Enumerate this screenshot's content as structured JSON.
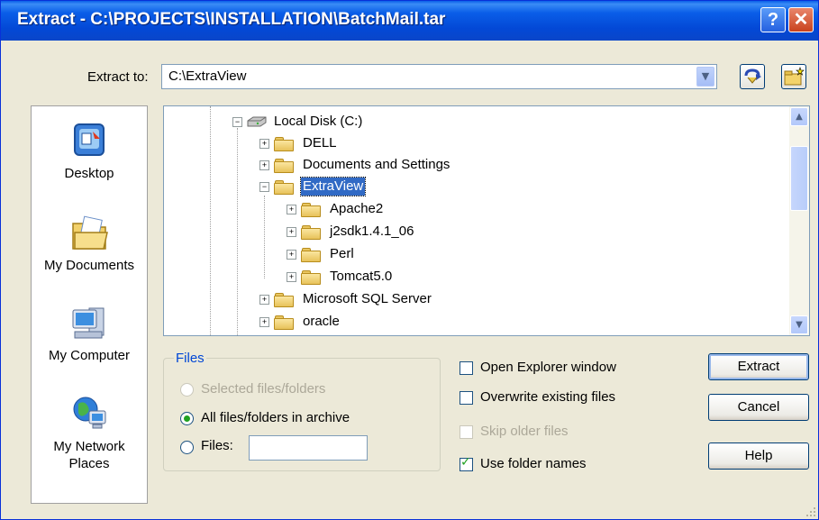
{
  "window": {
    "title": "Extract - C:\\PROJECTS\\INSTALLATION\\BatchMail.tar",
    "help_glyph": "?",
    "close_glyph": "✕"
  },
  "extract_to": {
    "label": "Extract to:",
    "value": "C:\\ExtraView"
  },
  "places": [
    {
      "label": "Desktop",
      "icon": "desktop-icon"
    },
    {
      "label": "My Documents",
      "icon": "my-documents-icon"
    },
    {
      "label": "My Computer",
      "icon": "my-computer-icon"
    },
    {
      "label": "My Network Places",
      "icon": "network-places-icon"
    }
  ],
  "tree": {
    "root": "Local Disk (C:)",
    "items": [
      {
        "label": "DELL",
        "level": 1,
        "expander": "+"
      },
      {
        "label": "Documents and Settings",
        "level": 1,
        "expander": "+"
      },
      {
        "label": "ExtraView",
        "level": 1,
        "expander": "−",
        "selected": true
      },
      {
        "label": "Apache2",
        "level": 2,
        "expander": "+"
      },
      {
        "label": "j2sdk1.4.1_06",
        "level": 2,
        "expander": "+"
      },
      {
        "label": "Perl",
        "level": 2,
        "expander": "+"
      },
      {
        "label": "Tomcat5.0",
        "level": 2,
        "expander": "+"
      },
      {
        "label": "Microsoft SQL Server",
        "level": 1,
        "expander": "+"
      },
      {
        "label": "oracle",
        "level": 1,
        "expander": "+"
      }
    ]
  },
  "files_group": {
    "title": "Files",
    "selected_files": "Selected files/folders",
    "all_files": "All files/folders in archive",
    "files_label": "Files:",
    "files_value": ""
  },
  "options": {
    "open_explorer": "Open Explorer window",
    "overwrite": "Overwrite existing files",
    "skip_older": "Skip older files",
    "use_folder_names": "Use folder names"
  },
  "buttons": {
    "extract": "Extract",
    "cancel": "Cancel",
    "help": "Help"
  }
}
